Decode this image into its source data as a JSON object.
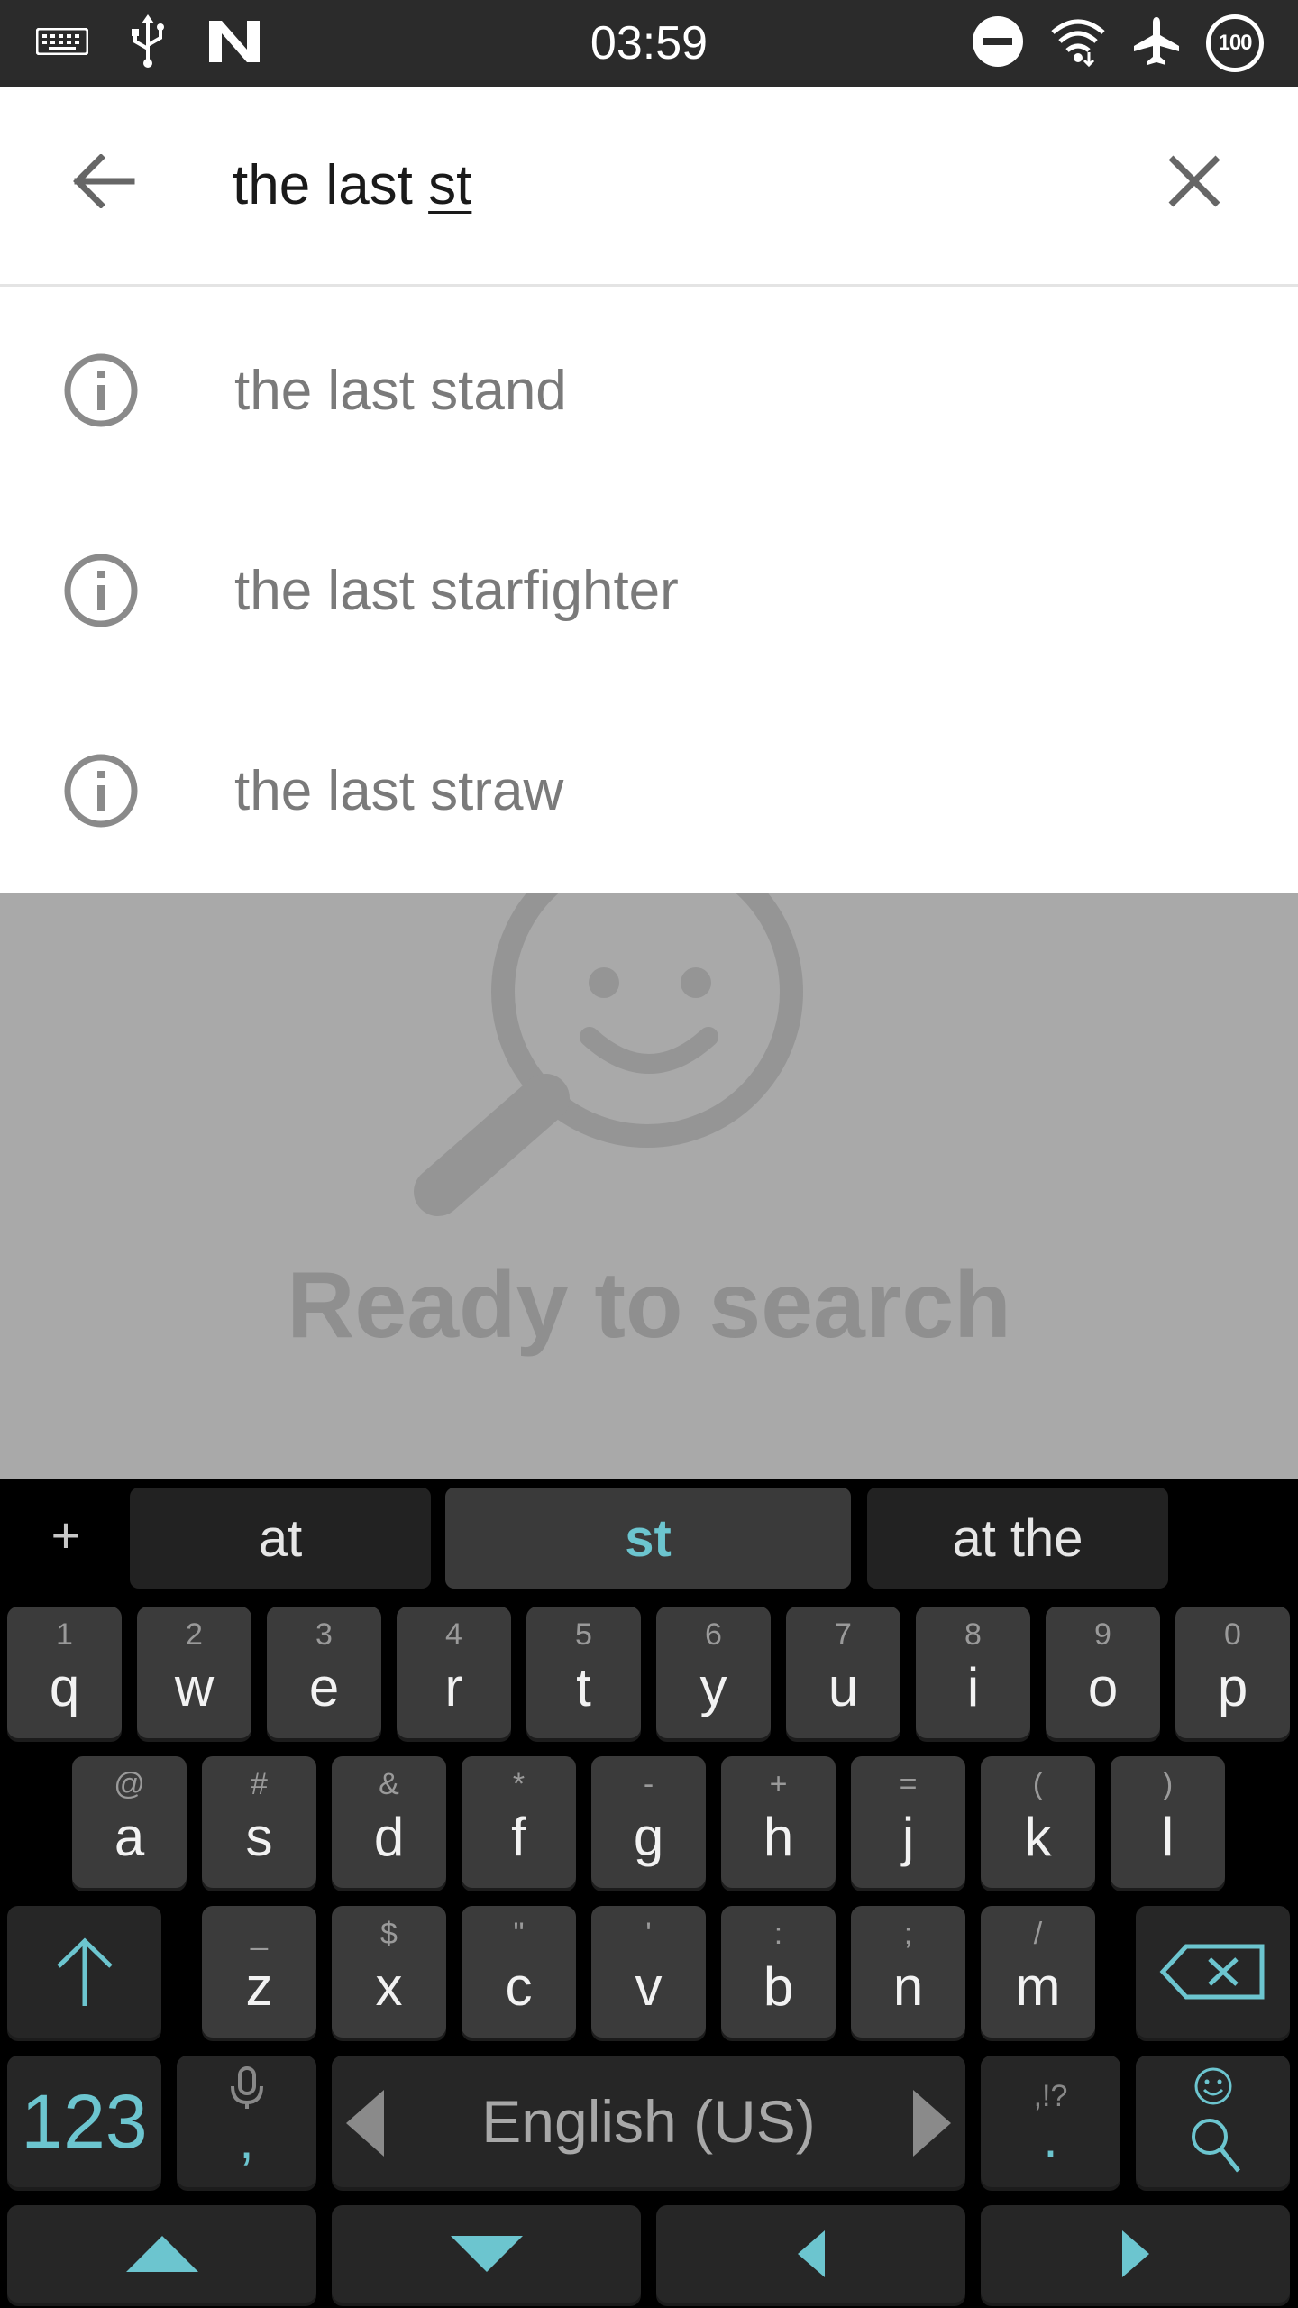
{
  "status_bar": {
    "time": "03:59",
    "battery": "100",
    "left_icons": [
      "keyboard-icon",
      "usb-icon",
      "n-notification-icon"
    ],
    "right_icons": [
      "do-not-disturb-icon",
      "wifi-icon",
      "airplane-mode-icon",
      "battery-icon"
    ]
  },
  "search": {
    "query_prefix": "the last ",
    "query_typed": "st",
    "back_icon": "arrow-back-icon",
    "clear_icon": "close-icon"
  },
  "suggestions": [
    {
      "label": "the last stand",
      "icon": "info-icon"
    },
    {
      "label": "the last starfighter",
      "icon": "info-icon"
    },
    {
      "label": "the last straw",
      "icon": "info-icon"
    }
  ],
  "empty_state": {
    "label": "Ready to search",
    "icon": "smiley-magnifier-icon"
  },
  "keyboard": {
    "plus_label": "+",
    "suggestions": [
      "at",
      "st",
      "at the"
    ],
    "row1": [
      {
        "hint": "1",
        "label": "q"
      },
      {
        "hint": "2",
        "label": "w"
      },
      {
        "hint": "3",
        "label": "e"
      },
      {
        "hint": "4",
        "label": "r"
      },
      {
        "hint": "5",
        "label": "t"
      },
      {
        "hint": "6",
        "label": "y"
      },
      {
        "hint": "7",
        "label": "u"
      },
      {
        "hint": "8",
        "label": "i"
      },
      {
        "hint": "9",
        "label": "o"
      },
      {
        "hint": "0",
        "label": "p"
      }
    ],
    "row2": [
      {
        "hint": "@",
        "label": "a"
      },
      {
        "hint": "#",
        "label": "s"
      },
      {
        "hint": "&",
        "label": "d"
      },
      {
        "hint": "*",
        "label": "f"
      },
      {
        "hint": "-",
        "label": "g"
      },
      {
        "hint": "+",
        "label": "h"
      },
      {
        "hint": "=",
        "label": "j"
      },
      {
        "hint": "(",
        "label": "k"
      },
      {
        "hint": ")",
        "label": "l"
      }
    ],
    "row3": [
      {
        "hint": "_",
        "label": "z"
      },
      {
        "hint": "$",
        "label": "x"
      },
      {
        "hint": "\"",
        "label": "c"
      },
      {
        "hint": "'",
        "label": "v"
      },
      {
        "hint": ":",
        "label": "b"
      },
      {
        "hint": ";",
        "label": "n"
      },
      {
        "hint": "/",
        "label": "m"
      }
    ],
    "numbers_label": "123",
    "comma_label": ",",
    "space_label": "English (US)",
    "period_hint": ",!?",
    "period_label": ".",
    "accent_color": "#6cc5cf"
  }
}
